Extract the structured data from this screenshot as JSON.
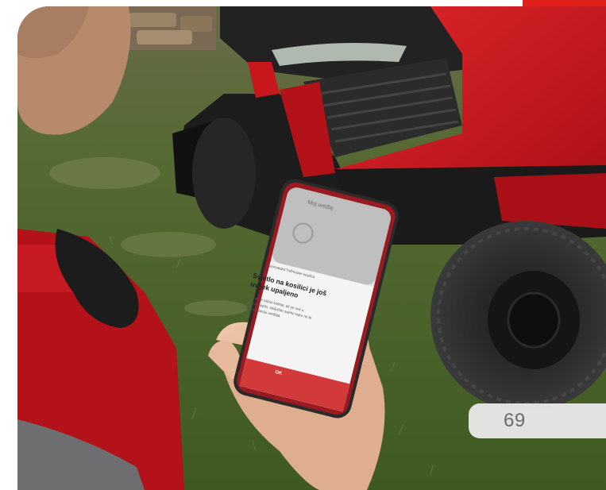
{
  "photo": {
    "subject": "",
    "page_number": "69",
    "phone_screen": {
      "top_title": "Moj uređaj",
      "device_row": "Automatska Tuffmower kosilica",
      "heading_line1": "Svjetlo na kosilici je još",
      "heading_line2": "uvijek upaljeno",
      "body_line1": "Gotovo je ciklus košnje, ali se ovo u",
      "body_line2": "kosilici svjetlo. Isključite svjetlo kako ne bi",
      "body_line3": "trošilo bateriju uređaja.",
      "button_label": "OK"
    }
  },
  "colors": {
    "accent": "#e1201c",
    "mower_red": "#c8161d",
    "grass": "#4b6a2a"
  }
}
